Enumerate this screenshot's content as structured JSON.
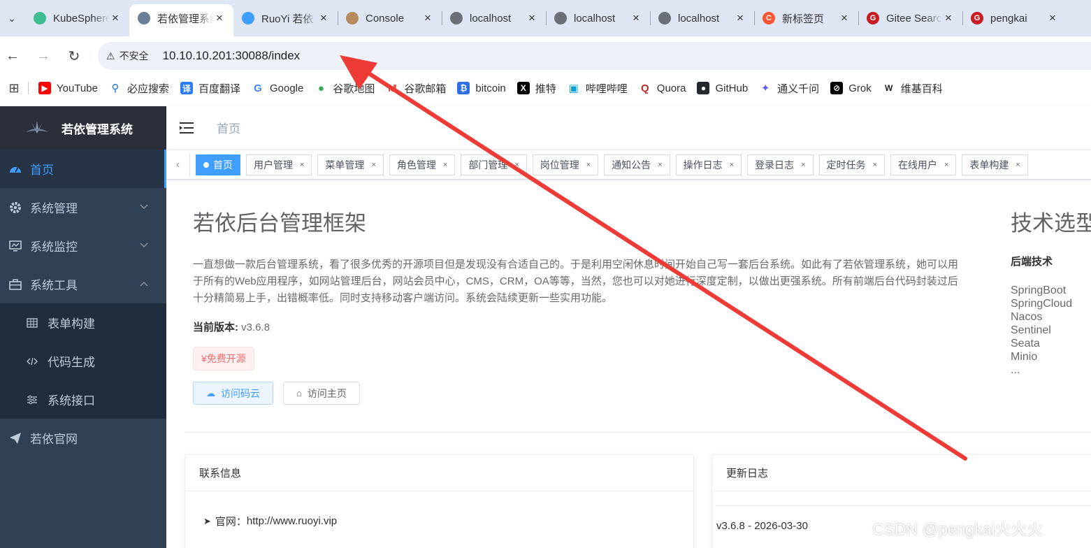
{
  "browser": {
    "tabs": [
      {
        "title": "KubeSphere",
        "favicon": "kubesphere-icon",
        "color": "#3ebd93",
        "active": false
      },
      {
        "title": "若依管理系统",
        "favicon": "ruoyi-logo-icon",
        "color": "#6b7e97",
        "active": true
      },
      {
        "title": "RuoYi 若依",
        "favicon": "ruoyi-logo-icon",
        "color": "#409eff",
        "active": false
      },
      {
        "title": "Console",
        "favicon": "avatar-icon",
        "color": "#b98a5c",
        "active": false
      },
      {
        "title": "localhost",
        "favicon": "globe-icon",
        "color": "#6b6f76",
        "active": false
      },
      {
        "title": "localhost",
        "favicon": "globe-icon",
        "color": "#6b6f76",
        "active": false
      },
      {
        "title": "localhost",
        "favicon": "globe-icon",
        "color": "#6b6f76",
        "active": false
      },
      {
        "title": "新标签页",
        "favicon": "csdn-icon",
        "color": "#fc5531",
        "active": false
      },
      {
        "title": "Gitee Search",
        "favicon": "gitee-icon",
        "color": "#c71d23",
        "active": false
      },
      {
        "title": "pengkai",
        "favicon": "gitee-icon",
        "color": "#c71d23",
        "active": false
      }
    ],
    "security_label": "不安全",
    "url": "10.10.10.201:30088/index",
    "bookmarks": [
      {
        "label": "YouTube",
        "icon": "youtube-icon",
        "color": "#ff0000",
        "glyph": "▶"
      },
      {
        "label": "必应搜索",
        "icon": "search-icon",
        "color": "#1a73e8",
        "glyph": "⚲"
      },
      {
        "label": "百度翻译",
        "icon": "baidu-translate-icon",
        "color": "#2b7cf4",
        "glyph": "译"
      },
      {
        "label": "Google",
        "icon": "google-icon",
        "color": "#4285f4",
        "glyph": "G"
      },
      {
        "label": "谷歌地图",
        "icon": "map-pin-icon",
        "color": "#34a853",
        "glyph": "●"
      },
      {
        "label": "谷歌邮箱",
        "icon": "gmail-icon",
        "color": "#ea4335",
        "glyph": "M"
      },
      {
        "label": "bitcoin",
        "icon": "bitcoin-icon",
        "color": "#2f6fe4",
        "glyph": "₿"
      },
      {
        "label": "推特",
        "icon": "x-icon",
        "color": "#000000",
        "glyph": "X"
      },
      {
        "label": "哔哩哔哩",
        "icon": "bilibili-icon",
        "color": "#00a1d6",
        "glyph": "▣"
      },
      {
        "label": "Quora",
        "icon": "quora-icon",
        "color": "#b92b27",
        "glyph": "Q"
      },
      {
        "label": "GitHub",
        "icon": "github-icon",
        "color": "#24292f",
        "glyph": "●"
      },
      {
        "label": "通义千问",
        "icon": "tongyi-icon",
        "color": "#615ced",
        "glyph": "✦"
      },
      {
        "label": "Grok",
        "icon": "grok-icon",
        "color": "#000000",
        "glyph": "⊘"
      },
      {
        "label": "维基百科",
        "icon": "wikipedia-icon",
        "color": "#ffffff",
        "glyph": "W"
      }
    ]
  },
  "app": {
    "logo_title": "若依管理系统",
    "breadcrumb": "首页",
    "accent": "#409eff",
    "sidebar_bg": "#304156"
  },
  "sidebar": {
    "items": [
      {
        "label": "首页",
        "icon": "dashboard-icon",
        "active": true
      },
      {
        "label": "系统管理",
        "icon": "gear-icon",
        "arrow": "chevron-down-icon"
      },
      {
        "label": "系统监控",
        "icon": "monitor-icon",
        "arrow": "chevron-down-icon"
      },
      {
        "label": "系统工具",
        "icon": "toolbox-icon",
        "arrow": "chevron-up-icon"
      }
    ],
    "sub_items": [
      {
        "label": "表单构建",
        "icon": "table-icon"
      },
      {
        "label": "代码生成",
        "icon": "code-icon"
      },
      {
        "label": "系统接口",
        "icon": "sliders-icon"
      }
    ],
    "official_site": {
      "label": "若依官网",
      "icon": "paper-plane-icon"
    }
  },
  "tags": [
    {
      "label": "首页",
      "active": true
    },
    {
      "label": "用户管理"
    },
    {
      "label": "菜单管理"
    },
    {
      "label": "角色管理"
    },
    {
      "label": "部门管理"
    },
    {
      "label": "岗位管理"
    },
    {
      "label": "通知公告"
    },
    {
      "label": "操作日志"
    },
    {
      "label": "登录日志"
    },
    {
      "label": "定时任务"
    },
    {
      "label": "在线用户"
    },
    {
      "label": "表单构建"
    }
  ],
  "intro": {
    "title": "若依后台管理框架",
    "description": "一直想做一款后台管理系统，看了很多优秀的开源项目但是发现没有合适自己的。于是利用空闲休息时间开始自己写一套后台系统。如此有了若依管理系统，她可以用于所有的Web应用程序，如网站管理后台，网站会员中心，CMS，CRM，OA等等，当然，您也可以对她进行深度定制，以做出更强系统。所有前端后台代码封装过后十分精简易上手，出错概率低。同时支持移动客户端访问。系统会陆续更新一些实用功能。",
    "version_label": "当前版本:",
    "version_value": "v3.6.8",
    "free_tag": "¥免费开源",
    "btn_gitee": "访问码云",
    "btn_home": "访问主页"
  },
  "tech": {
    "title": "技术选型",
    "backend_label": "后端技术",
    "backend_items": [
      "SpringBoot",
      "SpringCloud",
      "Nacos",
      "Sentinel",
      "Seata",
      "Minio",
      "..."
    ]
  },
  "contact": {
    "header": "联系信息",
    "site_label": "官网：",
    "site_value": "http://www.ruoyi.vip"
  },
  "changelog": {
    "header": "更新日志",
    "first_item": "v3.6.8 - 2026-03-30"
  },
  "annotation": {
    "watermark": "CSDN @pengkai火火火",
    "arrow_color": "#ef3b36"
  }
}
